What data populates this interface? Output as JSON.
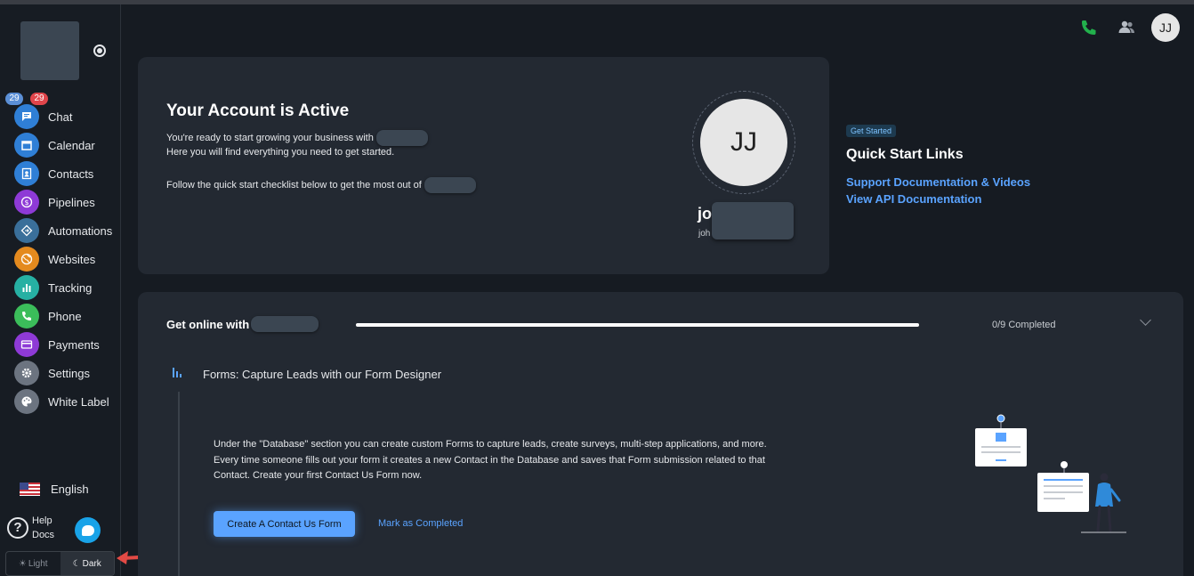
{
  "sidebar": {
    "badges": {
      "left": "29",
      "right": "29"
    },
    "items": [
      {
        "label": "Chat",
        "icon": "chat-icon",
        "color": "#2f7fd6"
      },
      {
        "label": "Calendar",
        "icon": "calendar-icon",
        "color": "#2f7fd6"
      },
      {
        "label": "Contacts",
        "icon": "contacts-icon",
        "color": "#2f7fd6"
      },
      {
        "label": "Pipelines",
        "icon": "dollar-icon",
        "color": "#8e3ad6"
      },
      {
        "label": "Automations",
        "icon": "automation-icon",
        "color": "#3a6f9a"
      },
      {
        "label": "Websites",
        "icon": "globe-icon",
        "color": "#e48a1e"
      },
      {
        "label": "Tracking",
        "icon": "bar-chart-icon",
        "color": "#26b0a3"
      },
      {
        "label": "Phone",
        "icon": "phone-icon",
        "color": "#3bbd5a"
      },
      {
        "label": "Payments",
        "icon": "card-icon",
        "color": "#8e3ad6"
      },
      {
        "label": "Settings",
        "icon": "gear-icon",
        "color": "#6c7480"
      },
      {
        "label": "White Label",
        "icon": "palette-icon",
        "color": "#6c7480"
      }
    ],
    "language": "English",
    "help_label": "Help Docs",
    "theme": {
      "light": "Light",
      "dark": "Dark",
      "active": "dark"
    }
  },
  "topbar": {
    "avatar_initials": "JJ"
  },
  "account": {
    "title": "Your Account is Active",
    "line1": "You're ready to start growing your business with",
    "line2": "Here you will find everything you need to get started.",
    "line3": "Follow the quick start checklist below to get the most out of",
    "avatar_initials": "JJ",
    "name": "jo",
    "email": "joh"
  },
  "quick_start": {
    "badge": "Get Started",
    "title": "Quick Start Links",
    "links": [
      "Support Documentation & Videos",
      "View API Documentation"
    ]
  },
  "onboarding": {
    "title": "Get online with",
    "progress": 0,
    "completed_label": "0/9 Completed",
    "step_title": "Forms: Capture Leads with our Form Designer",
    "description": "Under the \"Database\" section you can create custom Forms to capture leads, create surveys, multi-step applications, and more. Every time someone fills out your form it creates a new Contact in the Database and saves that Form submission related to that Contact. Create your first Contact Us Form now.",
    "primary_button": "Create A Contact Us Form",
    "secondary_button": "Mark as Completed"
  }
}
